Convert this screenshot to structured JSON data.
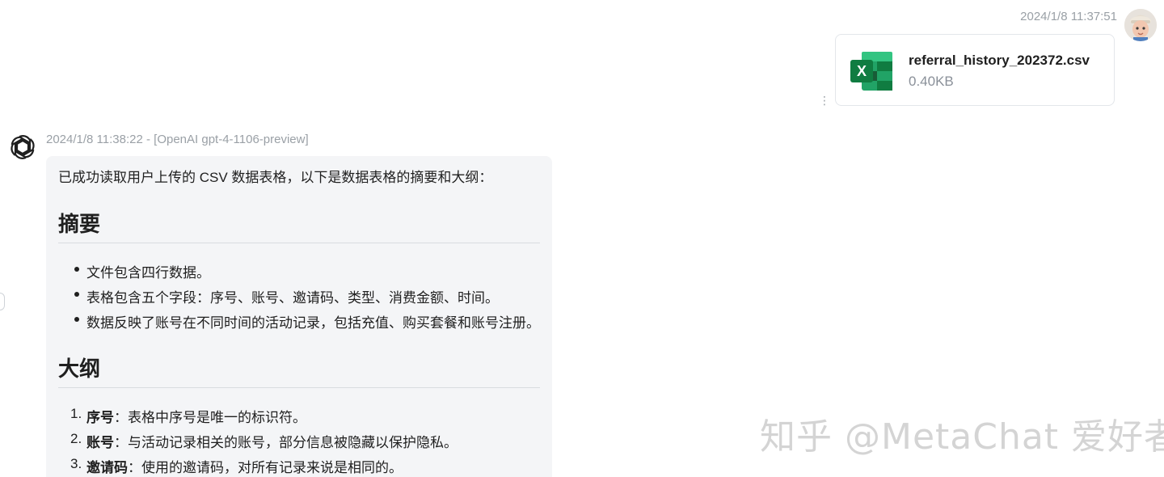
{
  "user_message": {
    "timestamp": "2024/1/8 11:37:51",
    "file": {
      "name": "referral_history_202372.csv",
      "size": "0.40KB",
      "icon": "excel-file-icon",
      "icon_letter": "X"
    },
    "more_icon": "more-vertical-icon"
  },
  "assistant_message": {
    "meta": "2024/1/8 11:38:22 - [OpenAI gpt-4-1106-preview]",
    "avatar_icon": "openai-logo-icon",
    "intro": "已成功读取用户上传的 CSV 数据表格，以下是数据表格的摘要和大纲：",
    "summary_heading": "摘要",
    "summary_items": [
      "文件包含四行数据。",
      "表格包含五个字段：序号、账号、邀请码、类型、消费金额、时间。",
      "数据反映了账号在不同时间的活动记录，包括充值、购买套餐和账号注册。"
    ],
    "outline_heading": "大纲",
    "outline_items": [
      {
        "num": "1.",
        "term": "序号",
        "text": "：表格中序号是唯一的标识符。"
      },
      {
        "num": "2.",
        "term": "账号",
        "text": "：与活动记录相关的账号，部分信息被隐藏以保护隐私。"
      },
      {
        "num": "3.",
        "term": "邀请码",
        "text": "：使用的邀请码，对所有记录来说是相同的。"
      }
    ]
  },
  "watermark": "知乎 @MetaChat 爱好者",
  "colors": {
    "excel_green": "#107C41",
    "bubble_bg": "#f4f5f7",
    "muted_text": "#9aa0a6"
  }
}
